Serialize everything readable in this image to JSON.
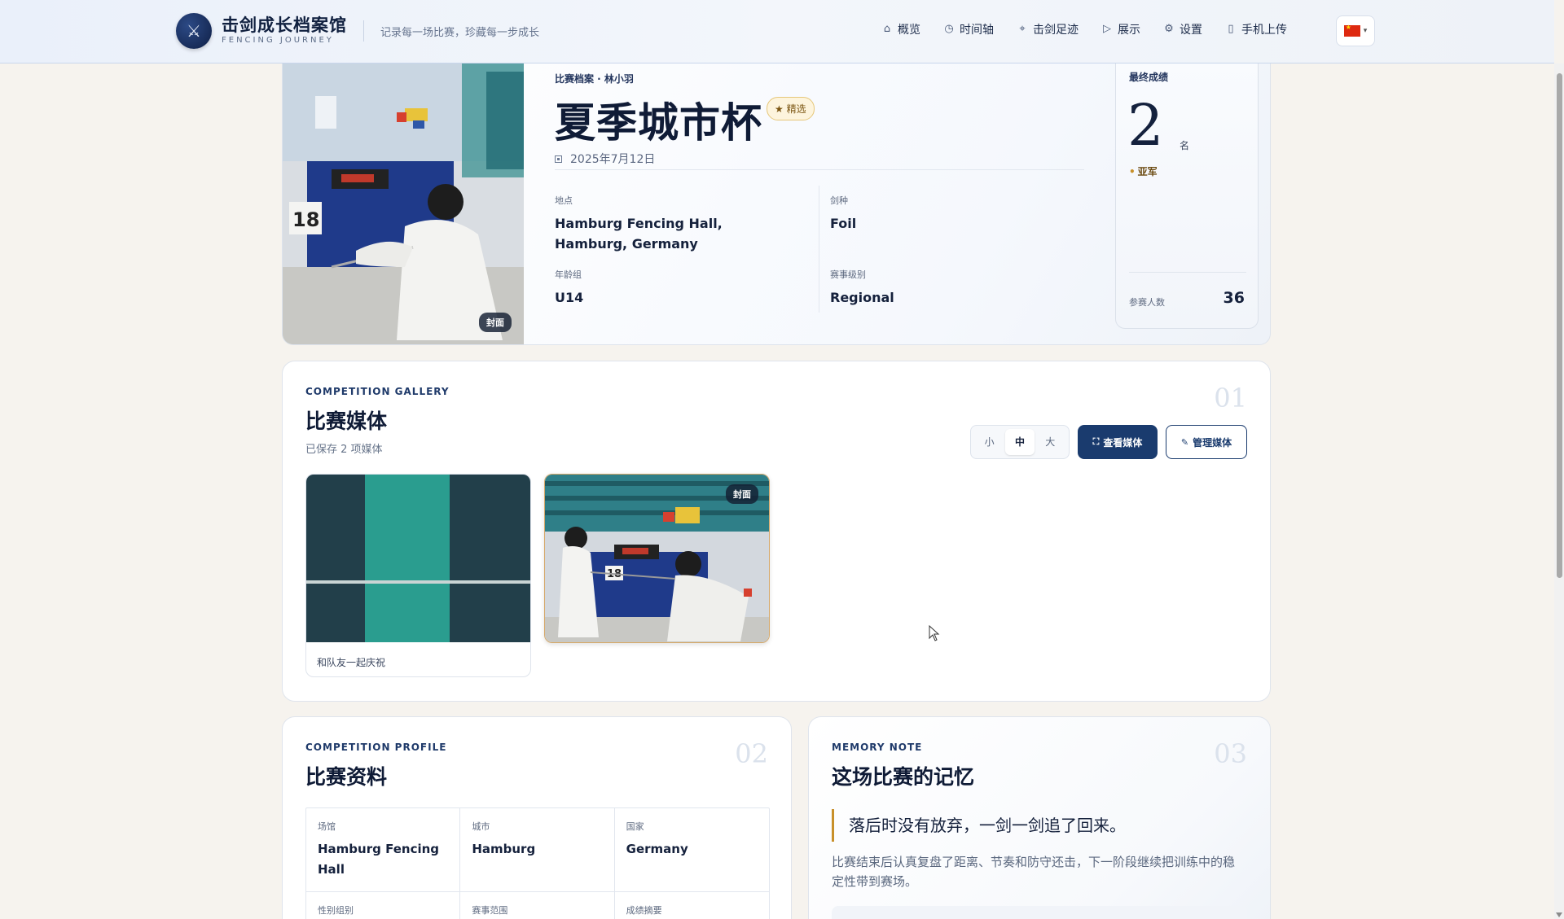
{
  "header": {
    "brand_title": "击剑成长档案馆",
    "brand_sub": "FENCING JOURNEY",
    "slogan": "记录每一场比赛，珍藏每一步成长",
    "nav": [
      {
        "label": "概览",
        "icon": "home-icon"
      },
      {
        "label": "时间轴",
        "icon": "clock-icon"
      },
      {
        "label": "击剑足迹",
        "icon": "map-pin-icon"
      },
      {
        "label": "展示",
        "icon": "play-icon"
      },
      {
        "label": "设置",
        "icon": "gear-icon"
      },
      {
        "label": "手机上传",
        "icon": "phone-icon"
      }
    ],
    "language_flag": "china-flag-icon"
  },
  "hero": {
    "breadcrumb": "比赛档案 · 林小羽",
    "title": "夏季城市杯",
    "featured_badge": "★ 精选",
    "date": "2025年7月12日",
    "cover_badge": "封面",
    "facts": {
      "location_label": "地点",
      "location_value": "Hamburg Fencing Hall, Hamburg, Germany",
      "weapon_label": "剑种",
      "weapon_value": "Foil",
      "age_label": "年龄组",
      "age_value": "U14",
      "level_label": "赛事级别",
      "level_value": "Regional"
    },
    "result": {
      "label": "最终成绩",
      "rank": "2",
      "rank_unit": "名",
      "medal": "亚军",
      "participants_label": "参赛人数",
      "participants_value": "36"
    }
  },
  "gallery": {
    "eyebrow": "COMPETITION GALLERY",
    "title": "比赛媒体",
    "number": "01",
    "subtitle": "已保存 2 项媒体",
    "sizes": [
      "小",
      "中",
      "大"
    ],
    "active_size": "中",
    "view_button": "查看媒体",
    "manage_button": "管理媒体",
    "items": [
      {
        "caption": "和队友一起庆祝"
      },
      {
        "badge": "封面"
      }
    ]
  },
  "profile": {
    "eyebrow": "COMPETITION PROFILE",
    "title": "比赛资料",
    "number": "02",
    "row1": [
      {
        "k": "场馆",
        "v": "Hamburg Fencing Hall"
      },
      {
        "k": "城市",
        "v": "Hamburg"
      },
      {
        "k": "国家",
        "v": "Germany"
      }
    ],
    "row2": [
      {
        "k": "性别组别",
        "v": ""
      },
      {
        "k": "赛事范围",
        "v": ""
      },
      {
        "k": "成绩摘要",
        "v": ""
      }
    ]
  },
  "memory": {
    "eyebrow": "MEMORY NOTE",
    "title": "这场比赛的记忆",
    "number": "03",
    "quote": "落后时没有放弃，一剑一剑追了回来。",
    "text": "比赛结束后认真复盘了距离、节奏和防守还击，下一阶段继续把训练中的稳定性带到赛场。"
  }
}
